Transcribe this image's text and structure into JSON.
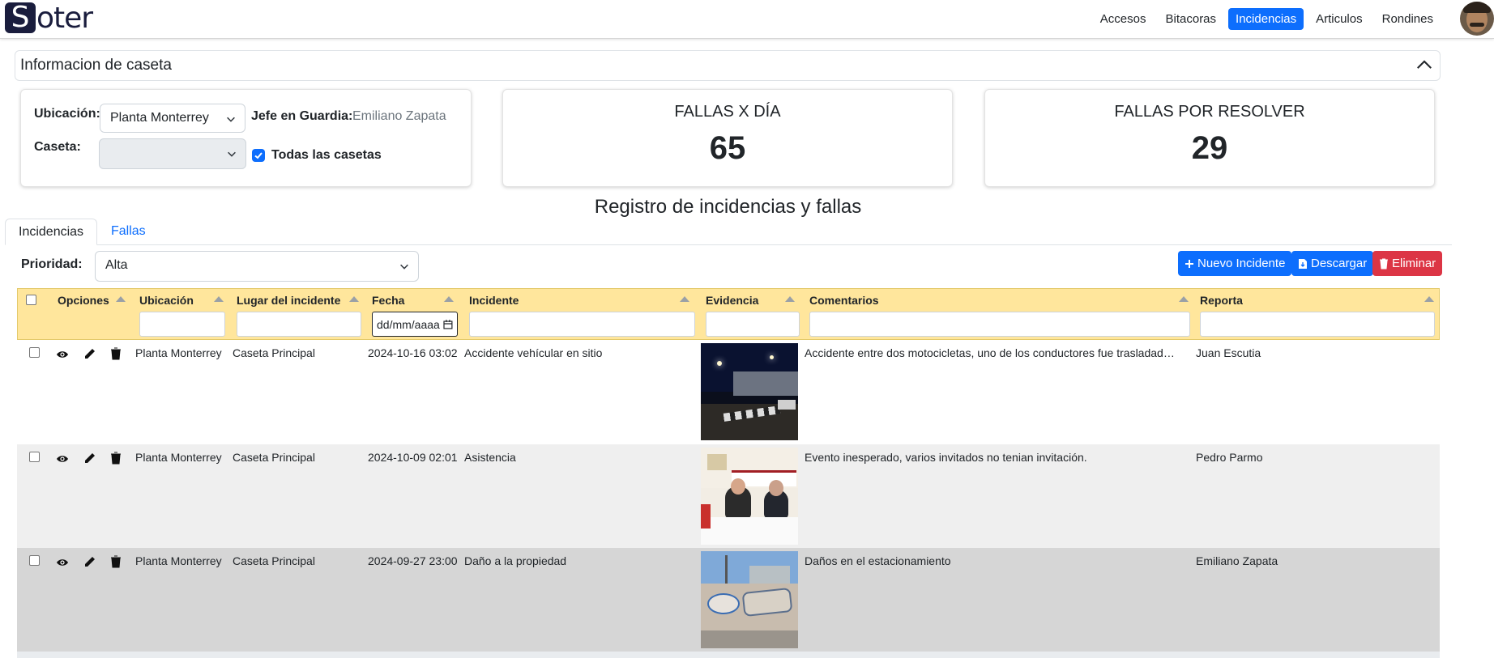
{
  "brand": {
    "logo_first": "S",
    "logo_rest": "oter"
  },
  "nav": {
    "items": [
      {
        "label": "Accesos"
      },
      {
        "label": "Bitacoras"
      },
      {
        "label": "Incidencias"
      },
      {
        "label": "Articulos"
      },
      {
        "label": "Rondines"
      }
    ],
    "active": "Incidencias"
  },
  "accordion": {
    "title": "Informacion de caseta"
  },
  "location_card": {
    "ubicacion_label": "Ubicación:",
    "ubicacion_value": "Planta Monterrey",
    "jefe_label": "Jefe en Guardia:",
    "jefe_value": "Emiliano Zapata",
    "caseta_label": "Caseta:",
    "caseta_value": "",
    "todas_label": "Todas las casetas",
    "todas_checked": true
  },
  "stats": [
    {
      "label": "FALLAS X DÍA",
      "value": "65"
    },
    {
      "label": "FALLAS POR RESOLVER",
      "value": "29"
    }
  ],
  "section_title": "Registro de incidencias y fallas",
  "tabs": [
    {
      "label": "Incidencias"
    },
    {
      "label": "Fallas"
    }
  ],
  "filters": {
    "prioridad_label": "Prioridad:",
    "prioridad_value": "Alta"
  },
  "actions": {
    "nuevo": "Nuevo Incidente",
    "descargar": "Descargar",
    "eliminar": "Eliminar"
  },
  "table": {
    "columns": [
      "Opciones",
      "Ubicación",
      "Lugar del incidente",
      "Fecha",
      "Incidente",
      "Evidencia",
      "Comentarios",
      "Reporta"
    ],
    "date_placeholder": "dd/mm/aaaa",
    "rows": [
      {
        "ubicacion": "Planta Monterrey",
        "lugar": "Caseta Principal",
        "fecha": "2024-10-16 03:02",
        "incidente": "Accidente vehícular en sitio",
        "comentarios": "Accidente entre dos motocicletas, uno de los conductores fue trasladad…",
        "reporta": "Juan Escutia"
      },
      {
        "ubicacion": "Planta Monterrey",
        "lugar": "Caseta Principal",
        "fecha": "2024-10-09 02:01",
        "incidente": "Asistencia",
        "comentarios": "Evento inesperado, varios invitados no tenian invitación.",
        "reporta": "Pedro Parmo"
      },
      {
        "ubicacion": "Planta Monterrey",
        "lugar": "Caseta Principal",
        "fecha": "2024-09-27 23:00",
        "incidente": "Daño a la propiedad",
        "comentarios": "Daños en el estacionamiento",
        "reporta": "Emiliano Zapata"
      }
    ]
  },
  "colors": {
    "primary": "#0d6efd",
    "danger": "#dc3545",
    "header_bg": "#ffe69c",
    "row_alt": "#efefef",
    "row_alt2": "#d6d6d6"
  }
}
